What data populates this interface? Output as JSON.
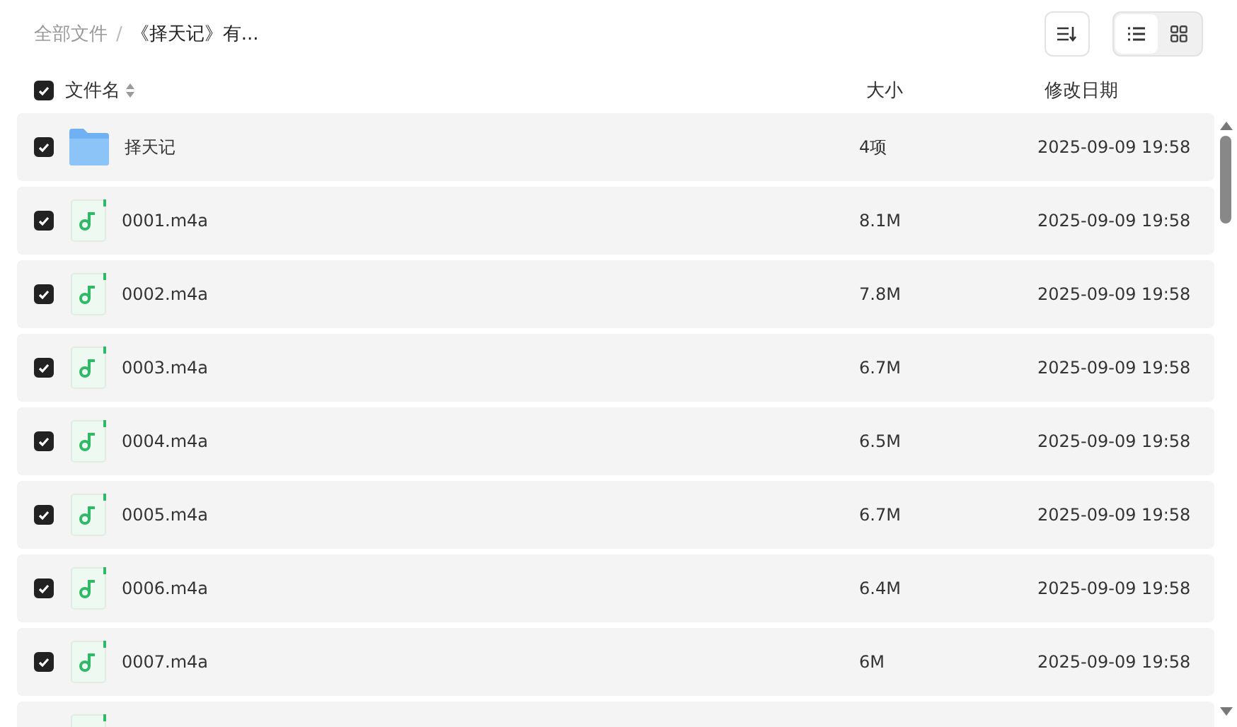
{
  "breadcrumb_separator": "/",
  "breadcrumb": [
    {
      "label": "全部文件",
      "current": false
    },
    {
      "label": "《择天记》有...",
      "current": true
    }
  ],
  "view_modes": [
    {
      "kind": "list",
      "selected": true
    },
    {
      "kind": "grid",
      "selected": false
    }
  ],
  "header": {
    "checked": true,
    "columns": [
      "文件名",
      "大小",
      "修改日期"
    ]
  },
  "rows": [
    {
      "kind": "folder",
      "checked": true,
      "name": "择天记",
      "size": "4项",
      "modified": "2025-09-09 19:58"
    },
    {
      "kind": "audio",
      "checked": true,
      "name": "0001.m4a",
      "size": "8.1M",
      "modified": "2025-09-09 19:58"
    },
    {
      "kind": "audio",
      "checked": true,
      "name": "0002.m4a",
      "size": "7.8M",
      "modified": "2025-09-09 19:58"
    },
    {
      "kind": "audio",
      "checked": true,
      "name": "0003.m4a",
      "size": "6.7M",
      "modified": "2025-09-09 19:58"
    },
    {
      "kind": "audio",
      "checked": true,
      "name": "0004.m4a",
      "size": "6.5M",
      "modified": "2025-09-09 19:58"
    },
    {
      "kind": "audio",
      "checked": true,
      "name": "0005.m4a",
      "size": "6.7M",
      "modified": "2025-09-09 19:58"
    },
    {
      "kind": "audio",
      "checked": true,
      "name": "0006.m4a",
      "size": "6.4M",
      "modified": "2025-09-09 19:58"
    },
    {
      "kind": "audio",
      "checked": true,
      "name": "0007.m4a",
      "size": "6M",
      "modified": "2025-09-09 19:58"
    },
    {
      "kind": "audio"
    }
  ]
}
